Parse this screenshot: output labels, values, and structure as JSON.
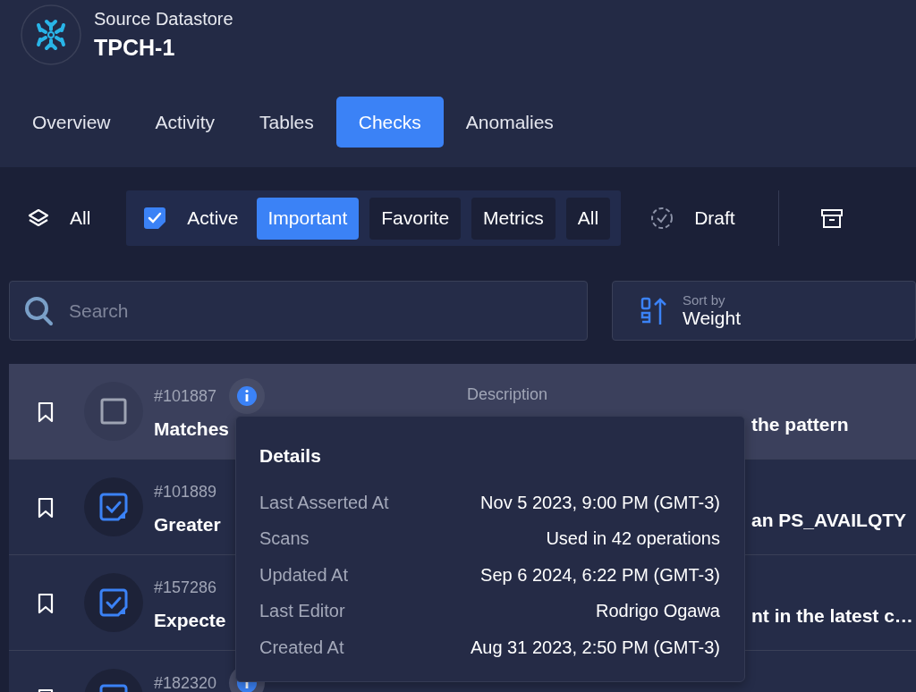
{
  "header": {
    "subtitle": "Source Datastore",
    "title": "TPCH-1"
  },
  "tabs": [
    {
      "label": "Overview",
      "selected": false
    },
    {
      "label": "Activity",
      "selected": false
    },
    {
      "label": "Tables",
      "selected": false
    },
    {
      "label": "Checks",
      "selected": true
    },
    {
      "label": "Anomalies",
      "selected": false
    }
  ],
  "filters": {
    "scope": {
      "label": "All"
    },
    "status": {
      "label": "Active"
    },
    "chips": [
      {
        "label": "Important",
        "selected": true
      },
      {
        "label": "Favorite",
        "selected": false
      },
      {
        "label": "Metrics",
        "selected": false
      },
      {
        "label": "All",
        "selected": false
      }
    ],
    "draft": {
      "label": "Draft"
    }
  },
  "search": {
    "placeholder": "Search"
  },
  "sort": {
    "label": "Sort by",
    "value": "Weight"
  },
  "checks": [
    {
      "id": "#101887",
      "title": "Matches",
      "description_label": "Description",
      "description": "the pattern",
      "checked": false,
      "selected": true,
      "info": true
    },
    {
      "id": "#101889",
      "title": "Greater",
      "description": "an PS_AVAILQTY",
      "checked": true,
      "selected": false,
      "info": false
    },
    {
      "id": "#157286",
      "title": "Expecte",
      "description": "nt in the latest c…",
      "checked": true,
      "selected": false,
      "info": false
    },
    {
      "id": "#182320",
      "checked": true,
      "selected": false,
      "info": true
    }
  ],
  "details": {
    "title": "Details",
    "rows": [
      {
        "label": "Last Asserted At",
        "value": "Nov 5 2023, 9:00 PM (GMT-3)"
      },
      {
        "label": "Scans",
        "value": "Used in 42 operations"
      },
      {
        "label": "Updated At",
        "value": "Sep 6 2024, 6:22 PM (GMT-3)"
      },
      {
        "label": "Last Editor",
        "value": "Rodrigo Ogawa"
      },
      {
        "label": "Created At",
        "value": "Aug 31 2023, 2:50 PM (GMT-3)"
      }
    ]
  }
}
